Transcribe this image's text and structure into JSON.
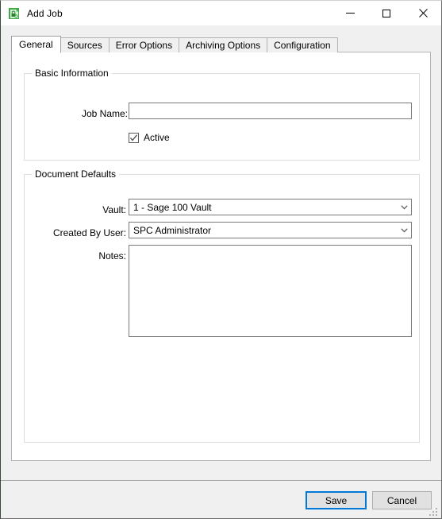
{
  "window": {
    "title": "Add Job",
    "icon": "app-document-lock-icon",
    "caption": {
      "minimize": "Minimize",
      "maximize": "Maximize",
      "close": "Close"
    }
  },
  "tabs": [
    {
      "label": "General",
      "active": true
    },
    {
      "label": "Sources",
      "active": false
    },
    {
      "label": "Error Options",
      "active": false
    },
    {
      "label": "Archiving Options",
      "active": false
    },
    {
      "label": "Configuration",
      "active": false
    }
  ],
  "basic_information": {
    "title": "Basic Information",
    "job_name": {
      "label": "Job Name:",
      "value": "",
      "placeholder": ""
    },
    "active": {
      "label": "Active",
      "checked": true
    }
  },
  "document_defaults": {
    "title": "Document Defaults",
    "vault": {
      "label": "Vault:",
      "value": "1 - Sage 100 Vault"
    },
    "created_by_user": {
      "label": "Created By User:",
      "value": "SPC  Administrator"
    },
    "notes": {
      "label": "Notes:",
      "value": "",
      "placeholder": ""
    }
  },
  "footer": {
    "save_label": "Save",
    "cancel_label": "Cancel"
  },
  "colors": {
    "accent": "#0078d7",
    "window_bg": "#f0f0f0",
    "panel_bg": "#ffffff",
    "border": "#b4b4b4",
    "icon_green": "#3faa47"
  }
}
